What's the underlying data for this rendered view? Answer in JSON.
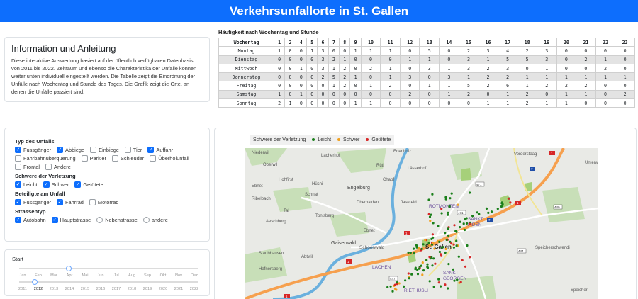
{
  "header": {
    "title": "Verkehrsunfallorte in St. Gallen"
  },
  "info": {
    "title": "Information und Anleitung",
    "text": "Diese interaktive Auswertung basiert auf der öffentlich verfügbaren Datenbasis von 2011 bis 2022. Zeitraum und ebenso die Charakteristika der Unfälle können weiter unten individuell eingestellt werden. Die Tabelle zeigt die Einordnung der Unfälle nach Wochentag und Stunde des Tages. Die Grafik zeigt die Orte, an denen die Unfälle passiert sind."
  },
  "table": {
    "title": "Häufigkeit nach Wochentag und Stunde",
    "corner": "Wochentag",
    "hours": [
      "1",
      "2",
      "4",
      "5",
      "6",
      "7",
      "8",
      "9",
      "10",
      "11",
      "12",
      "13",
      "14",
      "15",
      "16",
      "17",
      "18",
      "19",
      "20",
      "21",
      "22",
      "23"
    ],
    "rows": [
      {
        "day": "Montag",
        "values": [
          "1",
          "0",
          "0",
          "1",
          "3",
          "0",
          "0",
          "1",
          "1",
          "1",
          "0",
          "5",
          "0",
          "2",
          "3",
          "4",
          "2",
          "3",
          "0",
          "0",
          "0",
          "0"
        ]
      },
      {
        "day": "Dienstag",
        "values": [
          "0",
          "0",
          "0",
          "0",
          "3",
          "2",
          "1",
          "0",
          "0",
          "0",
          "1",
          "1",
          "0",
          "3",
          "1",
          "5",
          "5",
          "3",
          "0",
          "2",
          "1",
          "0"
        ]
      },
      {
        "day": "Mittwoch",
        "values": [
          "0",
          "0",
          "1",
          "0",
          "3",
          "1",
          "2",
          "0",
          "2",
          "1",
          "0",
          "3",
          "1",
          "3",
          "2",
          "3",
          "0",
          "1",
          "0",
          "0",
          "2",
          "0"
        ]
      },
      {
        "day": "Donnerstag",
        "values": [
          "0",
          "0",
          "0",
          "0",
          "2",
          "5",
          "2",
          "1",
          "0",
          "1",
          "3",
          "0",
          "3",
          "1",
          "2",
          "2",
          "1",
          "1",
          "1",
          "1",
          "1",
          "1"
        ]
      },
      {
        "day": "Freitag",
        "values": [
          "0",
          "0",
          "0",
          "0",
          "0",
          "1",
          "2",
          "0",
          "1",
          "2",
          "0",
          "1",
          "1",
          "5",
          "2",
          "6",
          "1",
          "2",
          "2",
          "2",
          "0",
          "0"
        ]
      },
      {
        "day": "Samstag",
        "values": [
          "1",
          "0",
          "1",
          "0",
          "0",
          "0",
          "0",
          "0",
          "0",
          "0",
          "2",
          "0",
          "1",
          "2",
          "0",
          "1",
          "2",
          "0",
          "1",
          "1",
          "0",
          "2"
        ]
      },
      {
        "day": "Sonntag",
        "values": [
          "2",
          "1",
          "0",
          "0",
          "0",
          "0",
          "0",
          "1",
          "1",
          "0",
          "0",
          "0",
          "0",
          "0",
          "1",
          "1",
          "2",
          "1",
          "1",
          "0",
          "0",
          "0"
        ]
      }
    ]
  },
  "filters": {
    "typ_title": "Typ des Unfalls",
    "typ": [
      {
        "label": "Fussgänger",
        "checked": true
      },
      {
        "label": "Abbiege",
        "checked": true
      },
      {
        "label": "Einbiege",
        "checked": false
      },
      {
        "label": "Tier",
        "checked": false
      },
      {
        "label": "Auffahr",
        "checked": true
      },
      {
        "label": "Fahrbahnüberquerung",
        "checked": false
      },
      {
        "label": "Parkier",
        "checked": false
      },
      {
        "label": "Schleuder",
        "checked": false
      },
      {
        "label": "Überholunfall",
        "checked": false
      },
      {
        "label": "Frontal",
        "checked": false
      },
      {
        "label": "Andere",
        "checked": false
      }
    ],
    "schwere_title": "Schwere der Verletzung",
    "schwere": [
      {
        "label": "Leicht",
        "checked": true
      },
      {
        "label": "Schwer",
        "checked": true
      },
      {
        "label": "Getötete",
        "checked": true
      }
    ],
    "beteiligte_title": "Beteiligte am Unfall",
    "beteiligte": [
      {
        "label": "Fussgänger",
        "checked": true
      },
      {
        "label": "Fahrrad",
        "checked": true
      },
      {
        "label": "Motorrad",
        "checked": false
      }
    ],
    "strasse_title": "Strassentyp",
    "strasse": [
      {
        "label": "Autobahn",
        "checked": true
      },
      {
        "label": "Hauptstrasse",
        "checked": true
      },
      {
        "label": "Nebenstrasse",
        "checked": false
      },
      {
        "label": "andere",
        "checked": false
      }
    ]
  },
  "slider": {
    "label": "Start",
    "months": [
      "Jan",
      "Feb",
      "Mar",
      "Apr",
      "Mai",
      "Jun",
      "Jul",
      "Aug",
      "Sep",
      "Okt",
      "Nov",
      "Dez"
    ],
    "selected_month": "Apr",
    "years": [
      "2011",
      "2012",
      "2013",
      "2014",
      "2015",
      "2016",
      "2017",
      "2018",
      "2019",
      "2020",
      "2021",
      "2022"
    ],
    "selected_year": "2012"
  },
  "map": {
    "legend_title": "Schwere der Verletzung",
    "legend": [
      {
        "label": "Leicht",
        "color": "#1a7f1a"
      },
      {
        "label": "Schwer",
        "color": "#f0a020"
      },
      {
        "label": "Getötete",
        "color": "#d62728"
      }
    ],
    "places": [
      "Niederwil",
      "Lacherhol",
      "Oberwil",
      "Rüti",
      "Erlenholz",
      "Lässerhof",
      "Vorderstaag",
      "Unterw",
      "Hohfirst",
      "Ebnet",
      "Hüchi",
      "Schnat",
      "Engelburg",
      "Chapf",
      "Rotmonten",
      "Ribelbach",
      "Tal",
      "Tonisberg",
      "Dberhalden",
      "Jasereid",
      "Sankt Fiden",
      "Aeschberg",
      "Ebnet",
      "Gaiserwald",
      "Schoenwald",
      "St. Gallen",
      "Staubhausen",
      "Abtwil",
      "Speicherschwendi",
      "Hafnersberg",
      "Lachen",
      "Sankt Georgen",
      "Riethüsli",
      "Speicher"
    ],
    "road_labels": [
      "1",
      "1",
      "1",
      "1",
      "1",
      "1",
      "7",
      "7",
      "471",
      "471",
      "440",
      "444",
      "447",
      "1",
      "3",
      "6"
    ]
  },
  "colors": {
    "accent": "#0d6efd",
    "leicht": "#1a7f1a",
    "schwer": "#f0a020",
    "getoetete": "#d62728"
  }
}
